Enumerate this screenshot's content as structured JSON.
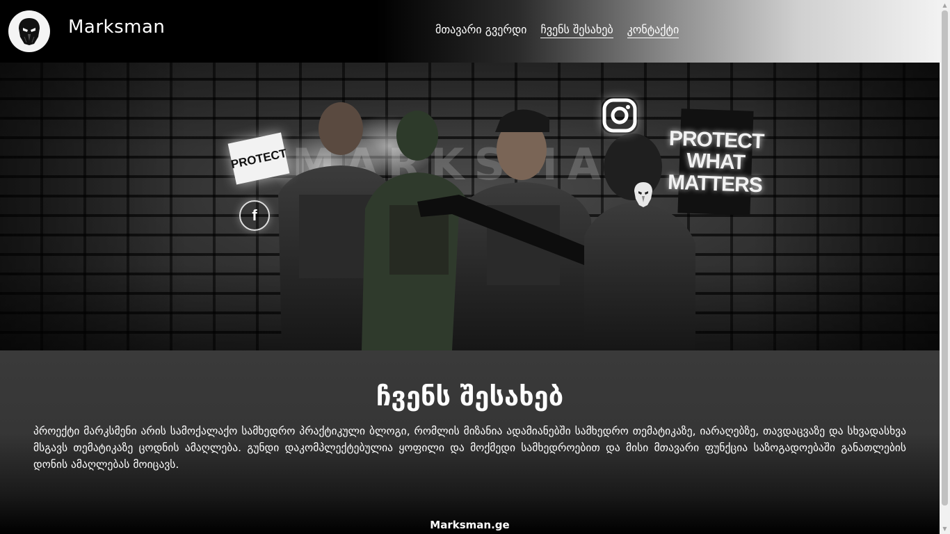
{
  "header": {
    "brand": "Marksman",
    "nav": [
      {
        "label": "მთავარი გვერდი"
      },
      {
        "label": "ჩვენს შესახებ"
      },
      {
        "label": "კონტაქტი"
      }
    ]
  },
  "hero": {
    "wordmark": "MARKSMAN",
    "sign_left": "PROTECT",
    "sign_right": "PROTECT WHAT MATTERS",
    "facebook_icon_glyph": "f",
    "icons": [
      "facebook-icon",
      "instagram-icon",
      "mask-logo-icon"
    ]
  },
  "about": {
    "title": "ჩვენს შესახებ",
    "body": "პროექტი მარკსმენი არის სამოქალაქო სამხედრო პრაქტიკული ბლოგი, რომლის მიზანია ადამიანებში სამხედრო თემატიკაზე, იარაღებზე, თავდაცვაზე და სხვადასხვა მსგავს თემატიკაზე ცოდნის ამაღლება. გუნდი დაკომპლექტებულია ყოფილი და მოქმედი სამხედროებით და მისი მთავარი ფუნქცია საზოგადოებაში განათლების დონის ამაღლებას მოიცავს."
  },
  "footer": {
    "text": "Marksman.ge"
  },
  "scrollbar": {
    "up_glyph": "▲",
    "down_glyph": "▼"
  },
  "colors": {
    "header_start": "#000000",
    "header_end": "#f2f2f2",
    "about_bg": "#3a3a3a",
    "logo_bg": "#f4f4f4"
  }
}
